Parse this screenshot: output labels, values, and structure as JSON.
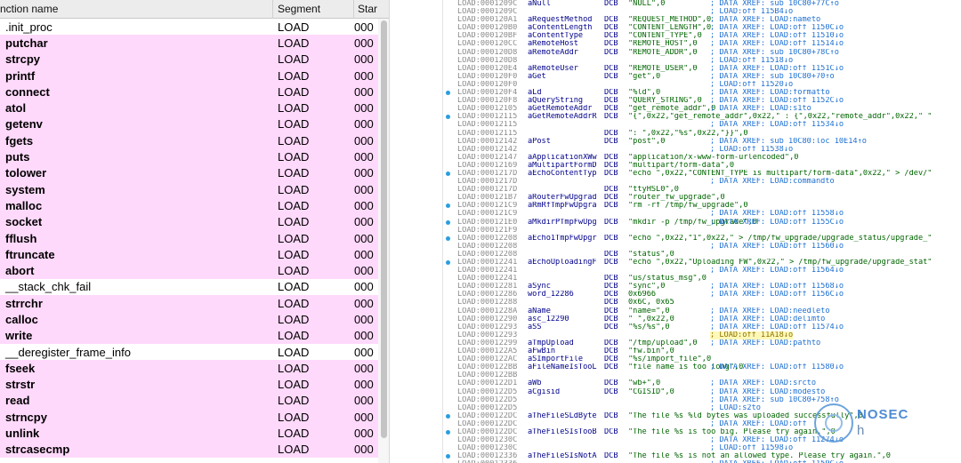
{
  "functions": {
    "columns": {
      "name": "nction name",
      "segment": "Segment",
      "start": "Star"
    },
    "rows": [
      {
        "name": ".init_proc",
        "segment": "LOAD",
        "start": "000",
        "external": false
      },
      {
        "name": "putchar",
        "segment": "LOAD",
        "start": "000",
        "external": true
      },
      {
        "name": "strcpy",
        "segment": "LOAD",
        "start": "000",
        "external": true
      },
      {
        "name": "printf",
        "segment": "LOAD",
        "start": "000",
        "external": true
      },
      {
        "name": "connect",
        "segment": "LOAD",
        "start": "000",
        "external": true
      },
      {
        "name": "atol",
        "segment": "LOAD",
        "start": "000",
        "external": true
      },
      {
        "name": "getenv",
        "segment": "LOAD",
        "start": "000",
        "external": true
      },
      {
        "name": "fgets",
        "segment": "LOAD",
        "start": "000",
        "external": true
      },
      {
        "name": "puts",
        "segment": "LOAD",
        "start": "000",
        "external": true
      },
      {
        "name": "tolower",
        "segment": "LOAD",
        "start": "000",
        "external": true
      },
      {
        "name": "system",
        "segment": "LOAD",
        "start": "000",
        "external": true
      },
      {
        "name": "malloc",
        "segment": "LOAD",
        "start": "000",
        "external": true
      },
      {
        "name": "socket",
        "segment": "LOAD",
        "start": "000",
        "external": true
      },
      {
        "name": "fflush",
        "segment": "LOAD",
        "start": "000",
        "external": true
      },
      {
        "name": "ftruncate",
        "segment": "LOAD",
        "start": "000",
        "external": true
      },
      {
        "name": "abort",
        "segment": "LOAD",
        "start": "000",
        "external": true
      },
      {
        "name": "__stack_chk_fail",
        "segment": "LOAD",
        "start": "000",
        "external": false
      },
      {
        "name": "strrchr",
        "segment": "LOAD",
        "start": "000",
        "external": true
      },
      {
        "name": "calloc",
        "segment": "LOAD",
        "start": "000",
        "external": true
      },
      {
        "name": "write",
        "segment": "LOAD",
        "start": "000",
        "external": true
      },
      {
        "name": "__deregister_frame_info",
        "segment": "LOAD",
        "start": "000",
        "external": false
      },
      {
        "name": "fseek",
        "segment": "LOAD",
        "start": "000",
        "external": true
      },
      {
        "name": "strstr",
        "segment": "LOAD",
        "start": "000",
        "external": true
      },
      {
        "name": "read",
        "segment": "LOAD",
        "start": "000",
        "external": true
      },
      {
        "name": "strncpy",
        "segment": "LOAD",
        "start": "000",
        "external": true
      },
      {
        "name": "unlink",
        "segment": "LOAD",
        "start": "000",
        "external": true
      },
      {
        "name": "strcasecmp",
        "segment": "LOAD",
        "start": "000",
        "external": true
      }
    ]
  },
  "listing": [
    {
      "addr": "LOAD:0001209C",
      "label": "aNull",
      "ins": "DCB",
      "ops": "\"NULL\",0",
      "cmt": "; DATA XREF: sub 10C80+77C↑o",
      "dot": false
    },
    {
      "addr": "LOAD:0001209C",
      "label": "",
      "ins": "",
      "ops": "",
      "cmt": "; LOAD:off 115B4↓o",
      "dot": false
    },
    {
      "addr": "LOAD:000120A1",
      "label": "aRequestMethod",
      "ins": "DCB",
      "ops": "\"REQUEST_METHOD\",0",
      "cmt": "; DATA XREF: LOAD:nameto",
      "dot": false
    },
    {
      "addr": "LOAD:000120B0",
      "label": "aContentLength",
      "ins": "DCB",
      "ops": "\"CONTENT_LENGTH\",0",
      "cmt": "; DATA XREF: LOAD:off 1150C↓o",
      "dot": false
    },
    {
      "addr": "LOAD:000120BF",
      "label": "aContentType",
      "ins": "DCB",
      "ops": "\"CONTENT_TYPE\",0",
      "cmt": "; DATA XREF: LOAD:off 11510↓o",
      "dot": false
    },
    {
      "addr": "LOAD:000120CC",
      "label": "aRemoteHost",
      "ins": "DCB",
      "ops": "\"REMOTE_HOST\",0",
      "cmt": "; DATA XREF: LOAD:off 11514↓o",
      "dot": false
    },
    {
      "addr": "LOAD:000120D8",
      "label": "aRemoteAddr",
      "ins": "DCB",
      "ops": "\"REMOTE_ADDR\",0",
      "cmt": "; DATA XREF: sub 10C80+78C↑o",
      "dot": false
    },
    {
      "addr": "LOAD:000120D8",
      "label": "",
      "ins": "",
      "ops": "",
      "cmt": "; LOAD:off 11518↓o",
      "dot": false
    },
    {
      "addr": "LOAD:000120E4",
      "label": "aRemoteUser",
      "ins": "DCB",
      "ops": "\"REMOTE_USER\",0",
      "cmt": "; DATA XREF: LOAD:off 1151C↓o",
      "dot": false
    },
    {
      "addr": "LOAD:000120F0",
      "label": "aGet",
      "ins": "DCB",
      "ops": "\"get\",0",
      "cmt": "; DATA XREF: sub 10C80+70↑o",
      "dot": false
    },
    {
      "addr": "LOAD:000120F0",
      "label": "",
      "ins": "",
      "ops": "",
      "cmt": "; LOAD:off 11520↓o",
      "dot": false
    },
    {
      "addr": "LOAD:000120F4",
      "label": "aLd",
      "ins": "DCB",
      "ops": "\"%ld\",0",
      "cmt": "; DATA XREF: LOAD:formatto",
      "dot": true
    },
    {
      "addr": "LOAD:000120F8",
      "label": "aQueryString",
      "ins": "DCB",
      "ops": "\"QUERY_STRING\",0",
      "cmt": "; DATA XREF: LOAD:off 1152C↓o",
      "dot": false
    },
    {
      "addr": "LOAD:00012105",
      "label": "aGetRemoteAddr",
      "ins": "DCB",
      "ops": "\"get_remote_addr\",0",
      "cmt": "; DATA XREF: LOAD:s1to",
      "dot": false
    },
    {
      "addr": "LOAD:00012115",
      "label": "aGetRemoteAddrR",
      "ins": "DCB",
      "ops": "\"{\",0x22,\"get_remote_addr\",0x22,\" : {\",0x22,\"remote_addr\",0x22,\" \"",
      "cmt": "",
      "dot": true
    },
    {
      "addr": "LOAD:00012115",
      "label": "",
      "ins": "",
      "ops": "",
      "cmt": "; DATA XREF: LOAD:off 11534↓o",
      "dot": false
    },
    {
      "addr": "LOAD:00012115",
      "label": "",
      "ins": "DCB",
      "ops": "\": \",0x22,\"%s\",0x22,\"}}\",0",
      "cmt": "",
      "dot": false
    },
    {
      "addr": "LOAD:00012142",
      "label": "aPost",
      "ins": "DCB",
      "ops": "\"post\",0",
      "cmt": "; DATA XREF: sub 10C80:loc 10E14↑o",
      "dot": false
    },
    {
      "addr": "LOAD:00012142",
      "label": "",
      "ins": "",
      "ops": "",
      "cmt": "; LOAD:off 11538↓o",
      "dot": false
    },
    {
      "addr": "LOAD:00012147",
      "label": "aApplicationXWw",
      "ins": "DCB",
      "ops": "\"application/x-www-form-urlencoded\",0",
      "cmt": "",
      "dot": false
    },
    {
      "addr": "LOAD:00012169",
      "label": "aMultipartFormD",
      "ins": "DCB",
      "ops": "\"multipart/form-data\",0",
      "cmt": "",
      "dot": false
    },
    {
      "addr": "LOAD:0001217D",
      "label": "aEchoContentTyp",
      "ins": "DCB",
      "ops": "\"echo \",0x22,\"CONTENT_TYPE is multipart/form-data\",0x22,\" > /dev/\"",
      "cmt": "",
      "dot": true
    },
    {
      "addr": "LOAD:0001217D",
      "label": "",
      "ins": "",
      "ops": "",
      "cmt": "; DATA XREF: LOAD:commandto",
      "dot": false
    },
    {
      "addr": "LOAD:0001217D",
      "label": "",
      "ins": "DCB",
      "ops": "\"ttyHSL0\",0",
      "cmt": "",
      "dot": false
    },
    {
      "addr": "LOAD:000121B7",
      "label": "aRouterFwUpgrad",
      "ins": "DCB",
      "ops": "\"router_fw_upgrade\",0",
      "cmt": "",
      "dot": false
    },
    {
      "addr": "LOAD:000121C9",
      "label": "aRmRfTmpFwUpgra",
      "ins": "DCB",
      "ops": "\"rm -rf /tmp/fw_upgrade\",0",
      "cmt": "",
      "dot": true
    },
    {
      "addr": "LOAD:000121C9",
      "label": "",
      "ins": "",
      "ops": "",
      "cmt": "; DATA XREF: LOAD:off 11558↓o",
      "dot": false
    },
    {
      "addr": "LOAD:000121E0",
      "label": "aMkdirPTmpFwUpg",
      "ins": "DCB",
      "ops": "\"mkdir -p /tmp/fw_upgrade\",0",
      "cmt": "; DATA XREF: LOAD:off 1155C↓o",
      "dot": true
    },
    {
      "addr": "LOAD:000121F9",
      "label": "",
      "ins": "",
      "ops": "",
      "cmt": "",
      "dot": false
    },
    {
      "addr": "LOAD:00012208",
      "label": "aEcho1TmpFwUpgr",
      "ins": "DCB",
      "ops": "\"echo \",0x22,\"1\",0x22,\" > /tmp/fw_upgrade/upgrade_status/upgrade_\"",
      "cmt": "",
      "dot": true
    },
    {
      "addr": "LOAD:00012208",
      "label": "",
      "ins": "",
      "ops": "",
      "cmt": "; DATA XREF: LOAD:off 11560↓o",
      "dot": false
    },
    {
      "addr": "LOAD:00012208",
      "label": "",
      "ins": "DCB",
      "ops": "\"status\",0",
      "cmt": "",
      "dot": false
    },
    {
      "addr": "LOAD:00012241",
      "label": "aEchoUploadingF",
      "ins": "DCB",
      "ops": "\"echo \",0x22,\"Uploading FW\",0x22,\" > /tmp/fw_upgrade/upgrade_stat\"",
      "cmt": "",
      "dot": true
    },
    {
      "addr": "LOAD:00012241",
      "label": "",
      "ins": "",
      "ops": "",
      "cmt": "; DATA XREF: LOAD:off 11564↓o",
      "dot": false
    },
    {
      "addr": "LOAD:00012241",
      "label": "",
      "ins": "DCB",
      "ops": "\"us/status_msg\",0",
      "cmt": "",
      "dot": false
    },
    {
      "addr": "LOAD:00012281",
      "label": "aSync",
      "ins": "DCB",
      "ops": "\"sync\",0",
      "cmt": "; DATA XREF: LOAD:off 11568↓o",
      "dot": false
    },
    {
      "addr": "LOAD:00012286",
      "label": "word_12286",
      "ins": "DCB",
      "ops": "0x6966",
      "cmt": "; DATA XREF: LOAD:off 1156C↓o",
      "dot": false
    },
    {
      "addr": "LOAD:00012288",
      "label": "",
      "ins": "DCB",
      "ops": "0x6C, 0x65",
      "cmt": "",
      "dot": false
    },
    {
      "addr": "LOAD:0001228A",
      "label": "aName",
      "ins": "DCB",
      "ops": "\"name=\",0",
      "cmt": "; DATA XREF: LOAD:needleto",
      "dot": false
    },
    {
      "addr": "LOAD:00012290",
      "label": "asc_12290",
      "ins": "DCB",
      "ops": "\" \",0x22,0",
      "cmt": "; DATA XREF: LOAD:delimto",
      "dot": false
    },
    {
      "addr": "LOAD:00012293",
      "label": "aSS",
      "ins": "DCB",
      "ops": "\"%s/%s\",0",
      "cmt": "; DATA XREF: LOAD:off 11574↓o",
      "dot": false
    },
    {
      "addr": "LOAD:00012293",
      "label": "",
      "ins": "",
      "ops": "",
      "cmt": "; LOAD:off 11A18↓o",
      "dot": false,
      "highlight": true
    },
    {
      "addr": "LOAD:00012299",
      "label": "aTmpUpload",
      "ins": "DCB",
      "ops": "\"/tmp/upload\",0",
      "cmt": "; DATA XREF: LOAD:pathto",
      "dot": false
    },
    {
      "addr": "LOAD:000122A5",
      "label": "aFwBin",
      "ins": "DCB",
      "ops": "\"fw.bin\",0",
      "cmt": "",
      "dot": false
    },
    {
      "addr": "LOAD:000122AC",
      "label": "aSImportFile",
      "ins": "DCB",
      "ops": "\"%s/import_file\",0",
      "cmt": "",
      "dot": false
    },
    {
      "addr": "LOAD:000122BB",
      "label": "aFileNameIsTooL",
      "ins": "DCB",
      "ops": "\"file name is too long\",0",
      "cmt": "; DATA XREF: LOAD:off 11580↓o",
      "dot": false
    },
    {
      "addr": "LOAD:000122BB",
      "label": "",
      "ins": "",
      "ops": "",
      "cmt": "",
      "dot": false
    },
    {
      "addr": "LOAD:000122D1",
      "label": "aWb",
      "ins": "DCB",
      "ops": "\"wb+\",0",
      "cmt": "; DATA XREF: LOAD:srcto",
      "dot": false
    },
    {
      "addr": "LOAD:000122D5",
      "label": "aCgisid",
      "ins": "DCB",
      "ops": "\"CGISID\",0",
      "cmt": "; DATA XREF: LOAD:modesto",
      "dot": false
    },
    {
      "addr": "LOAD:000122D5",
      "label": "",
      "ins": "",
      "ops": "",
      "cmt": "; DATA XREF: sub 10C80+758↑o",
      "dot": false
    },
    {
      "addr": "LOAD:000122D5",
      "label": "",
      "ins": "",
      "ops": "",
      "cmt": "; LOAD:s2to",
      "dot": false
    },
    {
      "addr": "LOAD:000122DC",
      "label": "aTheFileSLdByte",
      "ins": "DCB",
      "ops": "\"The file %s %ld bytes was uploaded successfully\",0",
      "cmt": "",
      "dot": true
    },
    {
      "addr": "LOAD:000122DC",
      "label": "",
      "ins": "",
      "ops": "",
      "cmt": "; DATA XREF: LOAD:off",
      "dot": false
    },
    {
      "addr": "LOAD:000122DC",
      "label": "aTheFileSIsTooB",
      "ins": "DCB",
      "ops": "\"The file %s is too big. Please try again.\",0",
      "cmt": "",
      "dot": true
    },
    {
      "addr": "LOAD:0001230C",
      "label": "",
      "ins": "",
      "ops": "",
      "cmt": "; DATA XREF: LOAD:off 11274↓o",
      "dot": false
    },
    {
      "addr": "LOAD:0001230C",
      "label": "",
      "ins": "",
      "ops": "",
      "cmt": "; LOAD:off 11598↓o",
      "dot": false
    },
    {
      "addr": "LOAD:00012336",
      "label": "aTheFileSIsNotA",
      "ins": "DCB",
      "ops": "\"The file %s is not an allowed type. Please try again.\",0",
      "cmt": "",
      "dot": true
    },
    {
      "addr": "LOAD:00012336",
      "label": "",
      "ins": "",
      "ops": "",
      "cmt": "; DATA XREF: LOAD:off 1159C↓o",
      "dot": false
    }
  ],
  "watermark": {
    "line1": "NOSEC",
    "line2": "h"
  },
  "colors": {
    "external_row_bg": "#ffd9fb",
    "address": "#8a8a8a",
    "label": "#00008b",
    "string": "#006400",
    "xref_comment": "#1d6fd1",
    "selection_dot": "#2a9ee0"
  }
}
